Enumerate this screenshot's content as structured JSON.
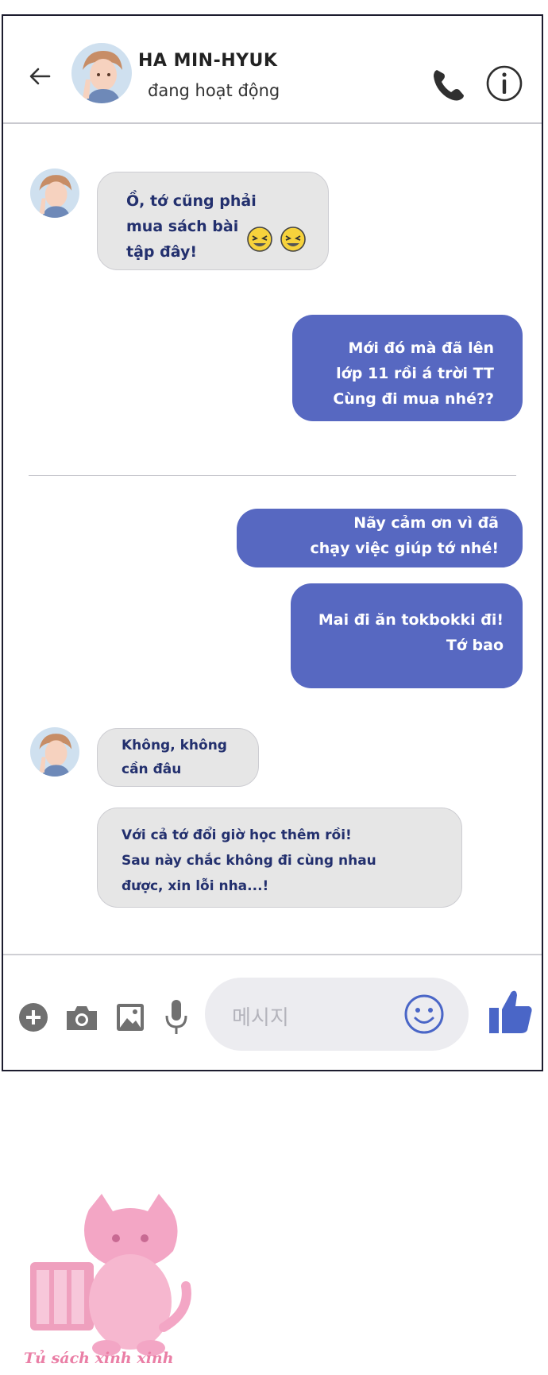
{
  "header": {
    "name": "HA MIN-HYUK",
    "status": "đang hoạt động"
  },
  "messages": [
    {
      "side": "in",
      "text": "Ồ, tớ cũng phải\nmua sách bài\ntập đây!",
      "emoji": "laughing-face"
    },
    {
      "side": "out",
      "text": "Mới đó mà đã lên\nlớp 11 rồi á trời TT\nCùng đi mua nhé??"
    },
    {
      "side": "out",
      "text": "Nãy cảm ơn vì đã\nchạy việc giúp tớ nhé!"
    },
    {
      "side": "out",
      "text": "Mai đi ăn tokbokki đi!\nTớ bao"
    },
    {
      "side": "in",
      "text": "Không, không\ncần đâu"
    },
    {
      "side": "in",
      "text": "Với cả tớ đổi giờ học thêm rồi!\nSau này chắc không đi cùng nhau\nđược, xin lỗi nha...!"
    }
  ],
  "composer": {
    "placeholder": "메시지"
  },
  "watermark": {
    "text": "Tủ sách xinh xinh"
  },
  "colors": {
    "outgoing_bubble": "#5768c1",
    "incoming_bubble": "#e6e6e6",
    "accent": "#4a66c7"
  },
  "icons": [
    "back-arrow-icon",
    "phone-icon",
    "info-icon",
    "plus-icon",
    "camera-icon",
    "image-icon",
    "microphone-icon",
    "smiley-icon",
    "thumbs-up-icon"
  ]
}
